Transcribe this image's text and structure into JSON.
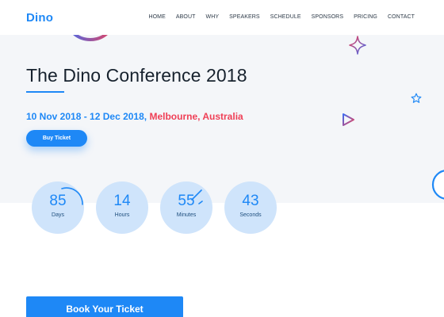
{
  "brand": {
    "logo": "Dino"
  },
  "nav": [
    {
      "label": "HOME"
    },
    {
      "label": "ABOUT"
    },
    {
      "label": "WHY"
    },
    {
      "label": "SPEAKERS"
    },
    {
      "label": "SCHEDULE"
    },
    {
      "label": "SPONSORS"
    },
    {
      "label": "PRICING"
    },
    {
      "label": "CONTACT"
    }
  ],
  "hero": {
    "title": "The Dino Conference 2018",
    "date_range": "10 Nov 2018 - 12 Dec 2018",
    "separator": ",",
    "location": " Melbourne, Australia",
    "buy_label": "Buy Ticket"
  },
  "countdown": [
    {
      "value": "85",
      "label": "Days"
    },
    {
      "value": "14",
      "label": "Hours"
    },
    {
      "value": "55",
      "label": "Minutes"
    },
    {
      "value": "43",
      "label": "Seconds"
    }
  ],
  "cta": {
    "book_label": "Book Your Ticket"
  },
  "colors": {
    "accent": "#1e88f6",
    "highlight": "#ef4057",
    "hero_bg": "#f4f6f9",
    "circle": "#cfe4fb"
  },
  "decorations": [
    "gradient-arc-icon",
    "star-4point-icon",
    "star-outline-icon",
    "play-triangle-icon",
    "ring-icon",
    "mini-arc-icon",
    "dash-icon"
  ]
}
